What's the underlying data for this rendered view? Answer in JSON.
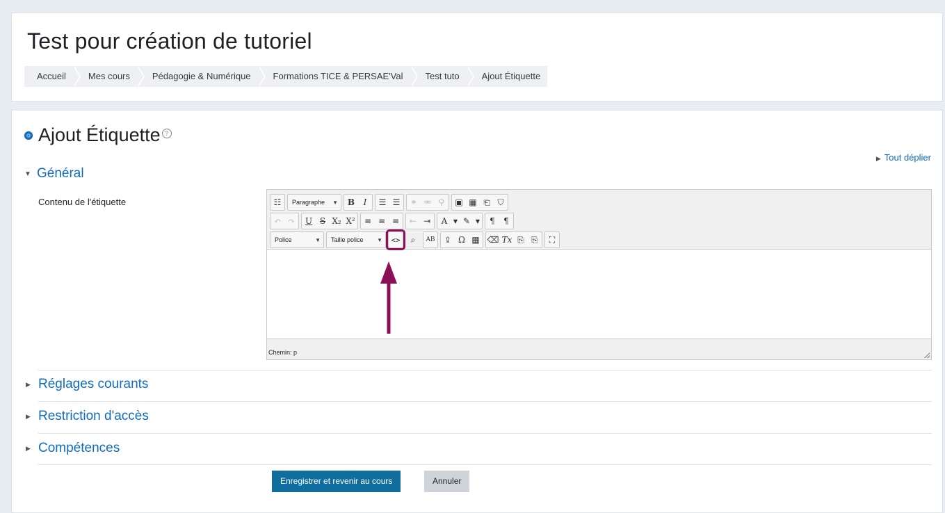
{
  "header": {
    "title": "Test pour création de tutoriel",
    "breadcrumb": [
      "Accueil",
      "Mes cours",
      "Pédagogie & Numérique",
      "Formations TICE & PERSAE'Val",
      "Test tuto",
      "Ajout Étiquette"
    ]
  },
  "form": {
    "title": "Ajout Étiquette",
    "help_glyph": "?",
    "expand_all": "Tout déplier",
    "general_section": "Général",
    "content_label": "Contenu de l'étiquette",
    "editor": {
      "format_select": "Paragraphe",
      "font_select": "Police",
      "size_select": "Taille police",
      "status_path": "Chemin: p"
    },
    "sections": [
      "Réglages courants",
      "Restriction d'accès",
      "Compétences"
    ],
    "save_button": "Enregistrer et revenir au cours",
    "cancel_button": "Annuler"
  },
  "colors": {
    "link": "#0f6cbf",
    "primary_button": "#0f6e9e",
    "annotation": "#8d0f56"
  }
}
